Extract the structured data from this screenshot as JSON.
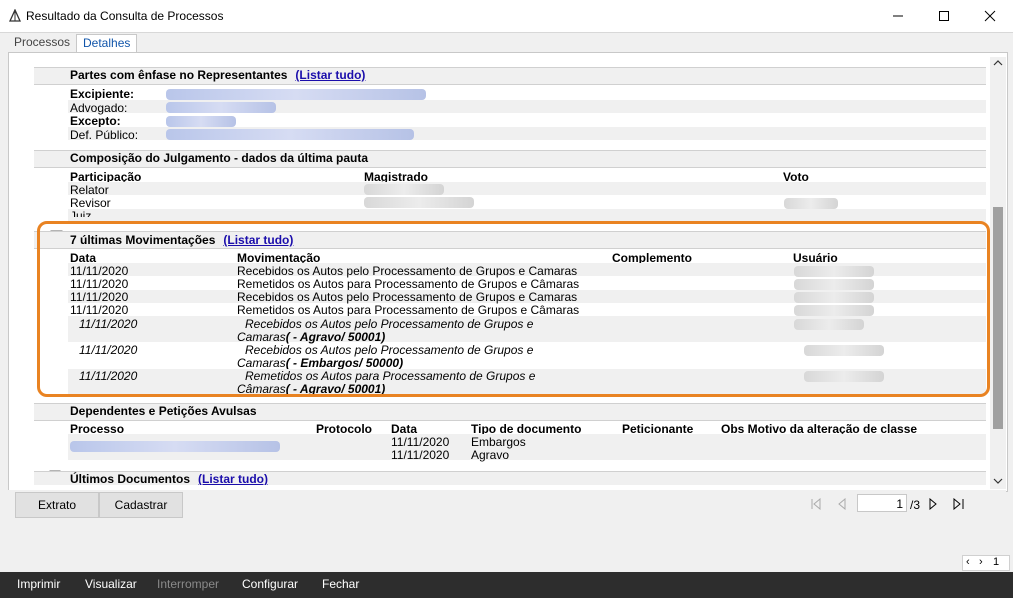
{
  "window": {
    "title": "Resultado da Consulta de Processos"
  },
  "tabs": [
    {
      "label": "Processos"
    },
    {
      "label": "Detalhes"
    }
  ],
  "sections": {
    "partes": {
      "title": "Partes com ênfase no Representantes",
      "link": "(Listar tudo)",
      "rows": [
        {
          "label": "Excipiente:"
        },
        {
          "label": "Advogado:"
        },
        {
          "label": "Excepto:"
        },
        {
          "label": "Def. Público:"
        }
      ]
    },
    "composicao": {
      "title": "Composição do Julgamento - dados da última pauta",
      "headers": {
        "participacao": "Participação",
        "magistrado": "Magistrado",
        "voto": "Voto"
      },
      "rows": [
        {
          "participacao": "Relator"
        },
        {
          "participacao": "Revisor"
        },
        {
          "participacao": "Juiz"
        }
      ]
    },
    "movimentacoes": {
      "title": "7 últimas Movimentações",
      "link": "(Listar tudo)",
      "headers": {
        "data": "Data",
        "movimentacao": "Movimentação",
        "complemento": "Complemento",
        "usuario": "Usuário"
      },
      "rows": [
        {
          "data": "11/11/2020",
          "mov": "Recebidos os Autos pelo Processamento de Grupos e Camaras"
        },
        {
          "data": "11/11/2020",
          "mov": "Remetidos os Autos para Processamento de Grupos e Câmaras"
        },
        {
          "data": "11/11/2020",
          "mov": "Recebidos os Autos pelo Processamento de Grupos e Camaras"
        },
        {
          "data": "11/11/2020",
          "mov": "Remetidos os Autos para Processamento de Grupos e Câmaras"
        }
      ],
      "italic_rows": [
        {
          "data": "11/11/2020",
          "line1": "Recebidos os Autos pelo Processamento de Grupos e",
          "line2a": "Camaras",
          "line2b": "( - Agravo/ 50001)"
        },
        {
          "data": "11/11/2020",
          "line1": "Recebidos os Autos pelo Processamento de Grupos e",
          "line2a": "Camaras",
          "line2b": "( - Embargos/ 50000)"
        },
        {
          "data": "11/11/2020",
          "line1": "Remetidos os Autos para Processamento de Grupos e",
          "line2a": "Câmaras",
          "line2b": "( - Agravo/ 50001)"
        }
      ]
    },
    "dependentes": {
      "title": "Dependentes e Petições Avulsas",
      "headers": {
        "processo": "Processo",
        "protocolo": "Protocolo",
        "data": "Data",
        "tipo": "Tipo de documento",
        "peticionante": "Peticionante",
        "obs": "Obs Motivo da alteração de classe"
      },
      "rows": [
        {
          "data": "11/11/2020",
          "tipo": "Embargos"
        },
        {
          "data": "11/11/2020",
          "tipo": "Agravo"
        }
      ]
    },
    "documentos": {
      "title": "Últimos Documentos",
      "link": "(Listar tudo)"
    }
  },
  "toolbar": {
    "extrato": "Extrato",
    "cadastrar": "Cadastrar"
  },
  "pager": {
    "current": "1",
    "total": "/3"
  },
  "mininav": {
    "page": "1"
  },
  "menubar": [
    {
      "label": "Imprimir",
      "enabled": true
    },
    {
      "label": "Visualizar",
      "enabled": true
    },
    {
      "label": "Interromper",
      "enabled": false
    },
    {
      "label": "Configurar",
      "enabled": true
    },
    {
      "label": "Fechar",
      "enabled": true
    }
  ],
  "colors": {
    "highlight": "#e98322",
    "link": "#1a0dab",
    "menubar": "#2d2d2d"
  }
}
